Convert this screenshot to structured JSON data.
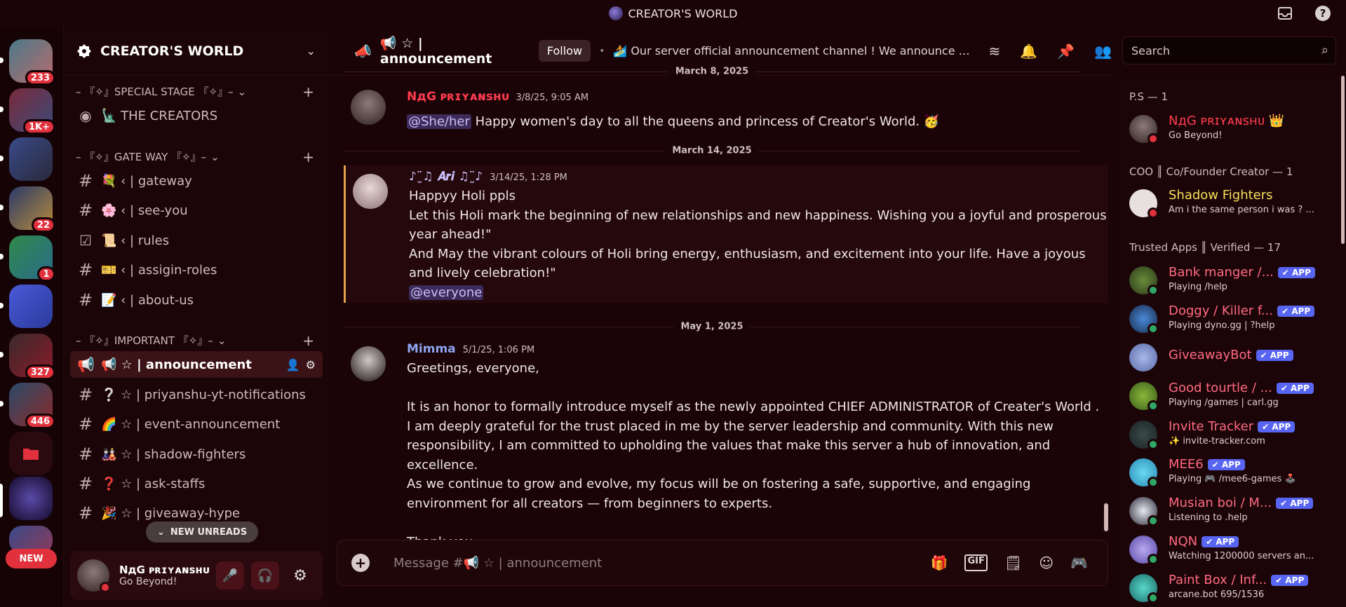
{
  "window": {
    "title": "CREATOR'S WORLD"
  },
  "rail": {
    "badges": [
      "233",
      "1K+",
      "22",
      "1",
      "327",
      "446"
    ],
    "new_label": "NEW"
  },
  "guild": {
    "name": "CREATOR'S WORLD"
  },
  "categories": {
    "special": "– 『✧』SPECIAL STAGE 『✧』–",
    "gateway": "– 『✧』GATE WAY 『✧』–",
    "important": "– 『✧』IMPORTANT 『✧』–"
  },
  "channels": {
    "creators": "🗽 THE CREATORS",
    "gateway": "💐 ‹ | gateway",
    "see_you": "🌸 ‹ | see-you",
    "rules": "📜 ‹ | rules",
    "assign_roles": "🎫 ‹ | assigin-roles",
    "about_us": "📝 ‹ | about-us",
    "announcement": "📢 ☆ | announcement",
    "yt_notifications": "❔ ☆ | priyanshu-yt-notifications",
    "event_announcement": "🌈 ☆ | event-announcement",
    "shadow_fighters": "🎎 ☆ | shadow-fighters",
    "ask_staffs": "❓ ☆ | ask-staffs",
    "giveaway": "🎉 ☆ | giveaway-hype"
  },
  "new_unreads": "NEW UNREADS",
  "user_panel": {
    "name": "NдG ᴘʀɪʏᴀɴꜱʜᴜ",
    "status": "Go Beyond!"
  },
  "header": {
    "channel": "📢 ☆ | announcement",
    "follow": "Follow",
    "topic": "🏄 Our server official announcement channel ! We announce all the im...",
    "search_placeholder": "Search"
  },
  "messages": [
    {
      "divider": "March 8, 2025",
      "author": "NдG ᴘʀɪʏᴀɴꜱʜᴜ",
      "author_color": "#ff3c4f",
      "time": "3/8/25, 9:05 AM",
      "mention": "@She/her",
      "text": " Happy women's day to all the queens and princess of Creator's World. 🥳"
    },
    {
      "divider": "March 14, 2025",
      "author": "♪¨̮♫ 𝑨𝒓𝒊 ♫¨̮♪",
      "author_color": "#c9bdf7",
      "time": "3/14/25, 1:28 PM",
      "lines": [
        "Happyy Holi ppls",
        "Let this Holi mark the beginning of new relationships and new happiness. Wishing you a joyful and prosperous year ahead!\"",
        "And May the vibrant colours of Holi bring energy, enthusiasm, and excitement into your life. Have a joyous and lively celebration!\""
      ],
      "mention": "@everyone"
    },
    {
      "divider": "May 1, 2025",
      "author": "Mimma",
      "author_color": "#8da4f0",
      "time": "5/1/25, 1:06 PM",
      "lines": [
        "Greetings, everyone,",
        "",
        "It is an honor to formally introduce myself as the newly appointed CHIEF ADMINISTRATOR of Creater's World .",
        "I am deeply grateful for the trust placed in me by the server leadership and community. With this new responsibility, I am committed to upholding the values that make this server a hub of innovation, and excellence.",
        "As we continue to grow and evolve, my focus will be on fostering a safe, supportive, and engaging environment for all creators — from beginners to experts.",
        "",
        "Thank you."
      ]
    }
  ],
  "composer": {
    "placeholder": "Message #📢 ☆ | announcement"
  },
  "member_groups": {
    "ps": "P.S — 1",
    "coo": "COO ║ Co/Founder Creator — 1",
    "apps": "Trusted Apps ║ Verified — 17"
  },
  "members": [
    {
      "name": "NдG ᴘʀɪʏᴀɴꜱʜᴜ 👑",
      "status": "Go Beyond!",
      "color": "#ff3c4f"
    },
    {
      "name": "Shadow Fighters",
      "status": "Am i the same person i was ? ...",
      "color": "#f6e05a"
    },
    {
      "name": "Bank manger /...",
      "status": "Playing /help",
      "color": "#ff6a80",
      "app": "✔ APP"
    },
    {
      "name": "Doggy / Killer f...",
      "status": "Playing dyno.gg | ?help",
      "color": "#ff6a80",
      "app": "✔ APP"
    },
    {
      "name": "GiveawayBot",
      "status": "",
      "color": "#ff6a80",
      "app": "✔ APP"
    },
    {
      "name": "Good tourtle / ...",
      "status": "Playing /games | carl.gg",
      "color": "#ff6a80",
      "app": "✔ APP"
    },
    {
      "name": "Invite Tracker",
      "status": "✨ invite-tracker.com",
      "color": "#ff6a80",
      "app": "✔ APP"
    },
    {
      "name": "MEE6",
      "status": "Playing 🎮 /mee6-games 🕹️",
      "color": "#ff6a80",
      "app": "✔ APP"
    },
    {
      "name": "Musian boi / M...",
      "status": "Listening to .help",
      "color": "#ff6a80",
      "app": "✔ APP"
    },
    {
      "name": "NQN",
      "status": "Watching 1200000 servers an...",
      "color": "#ff6a80",
      "app": "✔ APP"
    },
    {
      "name": "Paint Box / Inf...",
      "status": "arcane.bot 695/1536",
      "color": "#ff6a80",
      "app": "✔ APP"
    }
  ],
  "icons": {
    "inbox": "inbox-icon",
    "help": "help-icon",
    "megaphone": "megaphone-icon",
    "threads": "threads-icon",
    "bell": "bell-icon",
    "pin": "pin-icon",
    "members": "members-icon"
  }
}
